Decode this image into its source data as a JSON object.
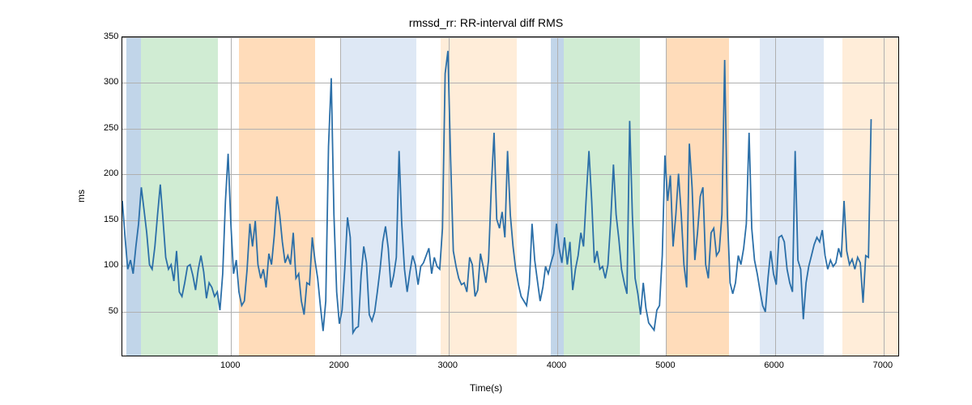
{
  "chart_data": {
    "type": "line",
    "title": "rmssd_rr: RR-interval diff RMS",
    "xlabel": "Time(s)",
    "ylabel": "ms",
    "xlim": [
      0,
      7150
    ],
    "ylim": [
      0,
      350
    ],
    "xticks": [
      1000,
      2000,
      3000,
      4000,
      5000,
      6000,
      7000
    ],
    "yticks": [
      50,
      100,
      150,
      200,
      250,
      300,
      350
    ],
    "bands": [
      {
        "x0": 40,
        "x1": 170,
        "class": "blue-dark"
      },
      {
        "x0": 170,
        "x1": 880,
        "class": "green"
      },
      {
        "x0": 1070,
        "x1": 1770,
        "class": "orange"
      },
      {
        "x0": 2000,
        "x1": 2700,
        "class": "blue-light"
      },
      {
        "x0": 2930,
        "x1": 3630,
        "class": "peach"
      },
      {
        "x0": 3940,
        "x1": 4060,
        "class": "blue-dark"
      },
      {
        "x0": 4060,
        "x1": 4760,
        "class": "green"
      },
      {
        "x0": 5000,
        "x1": 5580,
        "class": "orange"
      },
      {
        "x0": 5860,
        "x1": 6450,
        "class": "blue-light"
      },
      {
        "x0": 6620,
        "x1": 7140,
        "class": "peach"
      }
    ],
    "x": [
      0,
      25,
      50,
      75,
      100,
      125,
      150,
      175,
      200,
      225,
      250,
      275,
      300,
      325,
      350,
      375,
      400,
      425,
      450,
      475,
      500,
      525,
      550,
      575,
      600,
      625,
      650,
      675,
      700,
      725,
      750,
      775,
      800,
      825,
      850,
      875,
      900,
      925,
      950,
      975,
      1000,
      1025,
      1050,
      1075,
      1100,
      1125,
      1150,
      1175,
      1200,
      1225,
      1250,
      1275,
      1300,
      1325,
      1350,
      1375,
      1400,
      1425,
      1450,
      1475,
      1500,
      1525,
      1550,
      1575,
      1600,
      1625,
      1650,
      1675,
      1700,
      1725,
      1750,
      1775,
      1800,
      1825,
      1850,
      1875,
      1900,
      1925,
      1950,
      1975,
      2000,
      2025,
      2050,
      2075,
      2100,
      2125,
      2150,
      2175,
      2200,
      2225,
      2250,
      2275,
      2300,
      2325,
      2350,
      2375,
      2400,
      2425,
      2450,
      2475,
      2500,
      2525,
      2550,
      2575,
      2600,
      2625,
      2650,
      2675,
      2700,
      2725,
      2750,
      2775,
      2800,
      2825,
      2850,
      2875,
      2900,
      2925,
      2950,
      2975,
      3000,
      3025,
      3050,
      3075,
      3100,
      3125,
      3150,
      3175,
      3200,
      3225,
      3250,
      3275,
      3300,
      3325,
      3350,
      3375,
      3400,
      3425,
      3450,
      3475,
      3500,
      3525,
      3550,
      3575,
      3600,
      3625,
      3650,
      3675,
      3700,
      3725,
      3750,
      3775,
      3800,
      3825,
      3850,
      3875,
      3900,
      3925,
      3950,
      3975,
      4000,
      4025,
      4050,
      4075,
      4100,
      4125,
      4150,
      4175,
      4200,
      4225,
      4250,
      4275,
      4300,
      4325,
      4350,
      4375,
      4400,
      4425,
      4450,
      4475,
      4500,
      4525,
      4550,
      4575,
      4600,
      4625,
      4650,
      4675,
      4700,
      4725,
      4750,
      4775,
      4800,
      4825,
      4850,
      4875,
      4900,
      4925,
      4950,
      4975,
      5000,
      5025,
      5050,
      5075,
      5100,
      5125,
      5150,
      5175,
      5200,
      5225,
      5250,
      5275,
      5300,
      5325,
      5350,
      5375,
      5400,
      5425,
      5450,
      5475,
      5500,
      5525,
      5550,
      5575,
      5600,
      5625,
      5650,
      5675,
      5700,
      5725,
      5750,
      5775,
      5800,
      5825,
      5850,
      5875,
      5900,
      5925,
      5950,
      5975,
      6000,
      6025,
      6050,
      6075,
      6100,
      6125,
      6150,
      6175,
      6200,
      6225,
      6250,
      6275,
      6300,
      6325,
      6350,
      6375,
      6400,
      6425,
      6450,
      6475,
      6500,
      6525,
      6550,
      6575,
      6600,
      6625,
      6650,
      6675,
      6700,
      6725,
      6750,
      6775,
      6800,
      6825,
      6850,
      6875,
      6900,
      6925,
      6950,
      6975,
      7000,
      7025,
      7050,
      7075,
      7100,
      7125,
      7150
    ],
    "y": [
      170,
      130,
      95,
      105,
      90,
      120,
      145,
      185,
      160,
      135,
      100,
      95,
      120,
      155,
      188,
      150,
      108,
      95,
      100,
      82,
      115,
      70,
      65,
      80,
      98,
      100,
      88,
      72,
      95,
      110,
      92,
      63,
      80,
      75,
      65,
      70,
      50,
      90,
      170,
      222,
      145,
      90,
      105,
      70,
      55,
      60,
      95,
      145,
      120,
      148,
      100,
      85,
      95,
      75,
      112,
      100,
      132,
      175,
      155,
      125,
      102,
      110,
      100,
      135,
      85,
      90,
      60,
      45,
      80,
      78,
      130,
      105,
      85,
      55,
      27,
      60,
      230,
      305,
      155,
      70,
      35,
      50,
      95,
      152,
      130,
      25,
      30,
      32,
      88,
      120,
      102,
      45,
      38,
      48,
      70,
      95,
      125,
      142,
      118,
      75,
      88,
      108,
      225,
      145,
      95,
      70,
      92,
      110,
      100,
      78,
      98,
      102,
      110,
      118,
      90,
      108,
      98,
      95,
      140,
      310,
      335,
      215,
      115,
      98,
      85,
      78,
      80,
      70,
      108,
      100,
      65,
      72,
      112,
      98,
      80,
      105,
      185,
      245,
      150,
      140,
      158,
      130,
      225,
      155,
      120,
      95,
      78,
      65,
      60,
      55,
      78,
      145,
      105,
      82,
      60,
      75,
      98,
      90,
      102,
      112,
      145,
      118,
      102,
      130,
      100,
      125,
      72,
      95,
      110,
      135,
      120,
      175,
      225,
      170,
      102,
      115,
      95,
      98,
      85,
      100,
      148,
      210,
      155,
      128,
      95,
      80,
      68,
      258,
      155,
      85,
      68,
      45,
      80,
      52,
      36,
      32,
      28,
      50,
      55,
      110,
      220,
      170,
      198,
      120,
      155,
      200,
      155,
      100,
      75,
      233,
      185,
      105,
      135,
      175,
      185,
      100,
      85,
      135,
      140,
      110,
      115,
      155,
      325,
      155,
      80,
      68,
      80,
      110,
      100,
      118,
      145,
      245,
      140,
      105,
      90,
      72,
      55,
      48,
      86,
      115,
      90,
      78,
      130,
      132,
      125,
      95,
      80,
      70,
      225,
      105,
      95,
      40,
      80,
      98,
      110,
      122,
      130,
      125,
      138,
      110,
      95,
      105,
      98,
      102,
      118,
      108,
      170,
      115,
      100,
      106,
      95,
      108,
      102,
      58,
      110,
      108,
      260
    ]
  }
}
